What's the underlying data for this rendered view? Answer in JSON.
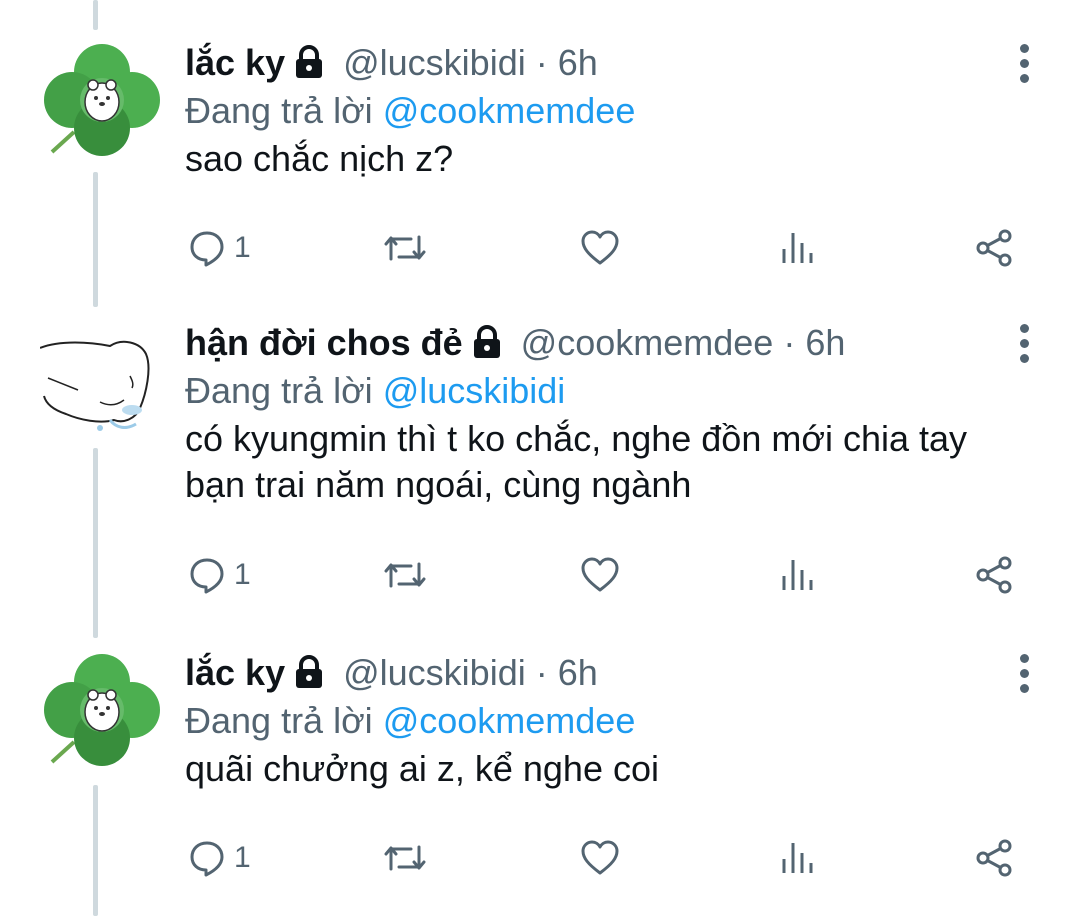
{
  "tweets": [
    {
      "name": "lắc ky",
      "handle": "@lucskibidi",
      "dot": "·",
      "time": "6h",
      "reply_prefix": "Đang trả lời ",
      "reply_to": "@cookmemdee",
      "text": "sao chắc nịch z?",
      "reply_count": "1",
      "avatar": "clover-bear-avatar"
    },
    {
      "name": "hận đời chos đẻ",
      "handle": "@cookmemdee",
      "dot": "·",
      "time": "6h",
      "reply_prefix": "Đang trả lời ",
      "reply_to": "@lucskibidi",
      "text": "có kyungmin thì t ko chắc, nghe đồn mới chia tay bạn trai năm ngoái, cùng ngành",
      "reply_count": "1",
      "avatar": "crying-sketch-avatar"
    },
    {
      "name": "lắc ky",
      "handle": "@lucskibidi",
      "dot": "·",
      "time": "6h",
      "reply_prefix": "Đang trả lời ",
      "reply_to": "@cookmemdee",
      "text": "quãi chưởng ai z, kể nghe coi",
      "reply_count": "1",
      "avatar": "clover-bear-avatar"
    }
  ],
  "colors": {
    "text": "#0f1419",
    "muted": "#536471",
    "accent": "#1d9bf0",
    "thread": "#cfd9de"
  },
  "icons": [
    "lock-icon",
    "more-icon",
    "reply-icon",
    "retweet-icon",
    "like-icon",
    "analytics-icon",
    "share-icon"
  ]
}
